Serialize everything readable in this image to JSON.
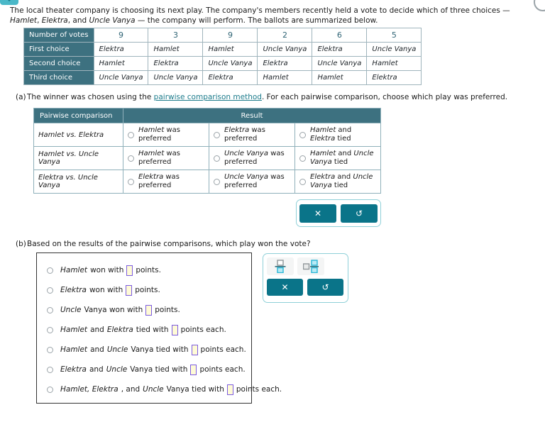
{
  "intro": {
    "text_before": "The local theater company is choosing its next play. The company's members recently held a vote to decide which of three choices — ",
    "play1": "Hamlet",
    "sep1": ", ",
    "play2": "Elektra",
    "sep2": ", and ",
    "play3": "Uncle Vanya",
    "text_after": " — the company will perform. The ballots are summarized below."
  },
  "ballot_table": {
    "row_headers": [
      "Number of votes",
      "First choice",
      "Second choice",
      "Third choice"
    ],
    "vote_counts": [
      "9",
      "3",
      "9",
      "2",
      "6",
      "5"
    ],
    "first_choice": [
      "Elektra",
      "Hamlet",
      "Hamlet",
      "Uncle Vanya",
      "Elektra",
      "Uncle Vanya"
    ],
    "second_choice": [
      "Hamlet",
      "Elektra",
      "Uncle Vanya",
      "Elektra",
      "Uncle Vanya",
      "Hamlet"
    ],
    "third_choice": [
      "Uncle Vanya",
      "Uncle Vanya",
      "Elektra",
      "Hamlet",
      "Hamlet",
      "Elektra"
    ]
  },
  "part_a": {
    "label": "(a)",
    "text_before_link": "The winner was chosen using the ",
    "link_text": "pairwise comparison method",
    "text_after_link": ". For each pairwise comparison, choose which play was preferred.",
    "headers": {
      "comparison": "Pairwise comparison",
      "result": "Result"
    },
    "rows": [
      {
        "comparison_a": "Hamlet",
        "comparison_vs": " vs. ",
        "comparison_b": "Elektra",
        "option1_em": "Hamlet",
        "option1_rest": " was preferred",
        "option2_em": "Elektra",
        "option2_rest": " was preferred",
        "option3_em1": "Hamlet",
        "option3_mid": " and ",
        "option3_em2": "Elektra",
        "option3_rest": " tied"
      },
      {
        "comparison_a": "Hamlet",
        "comparison_vs": " vs. ",
        "comparison_b": "Uncle Vanya",
        "option1_em": "Hamlet",
        "option1_rest": " was preferred",
        "option2_em": "Uncle Vanya",
        "option2_rest": " was preferred",
        "option3_em1": "Hamlet",
        "option3_mid": " and ",
        "option3_em2": "Uncle Vanya",
        "option3_rest": " tied"
      },
      {
        "comparison_a": "Elektra",
        "comparison_vs": " vs. ",
        "comparison_b": "Uncle Vanya",
        "option1_em": "Elektra",
        "option1_rest": " was preferred",
        "option2_em": "Uncle Vanya",
        "option2_rest": " was preferred",
        "option3_em1": "Elektra",
        "option3_mid": " and ",
        "option3_em2": "Uncle Vanya",
        "option3_rest": " tied"
      }
    ],
    "toolbar": {
      "clear_label": "✕",
      "undo_label": "↺"
    }
  },
  "part_b": {
    "label": "(b)",
    "question": "Based on the results of the pairwise comparisons, which play won the vote?",
    "options": [
      {
        "em1": "Hamlet",
        "mid1": " won with ",
        "value": "",
        "tail": "points."
      },
      {
        "em1": "Elektra",
        "mid1": " won with ",
        "value": "",
        "tail": "points."
      },
      {
        "em1": "Uncle",
        "mid1": " Vanya won with ",
        "value": "",
        "tail": "points."
      },
      {
        "em1": "Hamlet",
        "mid1": " and ",
        "em2": "Elektra",
        "mid2": " tied with ",
        "value": "",
        "tail": "points each."
      },
      {
        "em1": "Hamlet",
        "mid1": " and ",
        "em2": "Uncle",
        "mid2": " Vanya tied with ",
        "value": "",
        "tail": "points each."
      },
      {
        "em1": "Elektra",
        "mid1": " and ",
        "em2": "Uncle",
        "mid2": " Vanya tied with ",
        "value": "",
        "tail": "points each."
      },
      {
        "em1": "Hamlet, Elektra",
        "mid1": ", and ",
        "em2": "Uncle",
        "mid2": " Vanya tied with ",
        "value": "",
        "tail": "points each."
      }
    ],
    "toolbar": {
      "fraction_label": "",
      "mixed_label": "",
      "clear_label": "✕",
      "undo_label": "↺"
    }
  },
  "colors": {
    "header_teal": "#3d7180",
    "button_teal": "#0a7489",
    "link_teal": "#1d7c8c",
    "input_border": "#7b5ce0",
    "input_fill": "#fffbd6"
  }
}
